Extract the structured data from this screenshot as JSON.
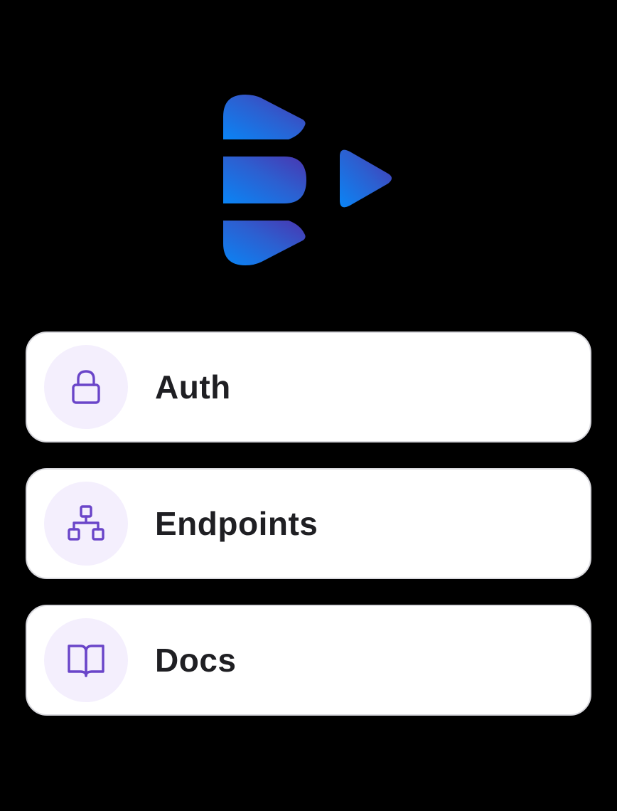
{
  "brand": {
    "logo_name": "brand-logo",
    "colors": {
      "gradient_start": "#0a84f5",
      "gradient_mid": "#2d5fd0",
      "gradient_end": "#4a36b0"
    }
  },
  "menu": {
    "items": [
      {
        "label": "Auth",
        "icon": "lock-icon"
      },
      {
        "label": "Endpoints",
        "icon": "sitemap-icon"
      },
      {
        "label": "Docs",
        "icon": "book-icon"
      }
    ]
  },
  "theme": {
    "background": "#000000",
    "card": "#ffffff",
    "icon_bg": "#f4effd",
    "icon_stroke": "#6a45c9",
    "text": "#1f1f23"
  }
}
